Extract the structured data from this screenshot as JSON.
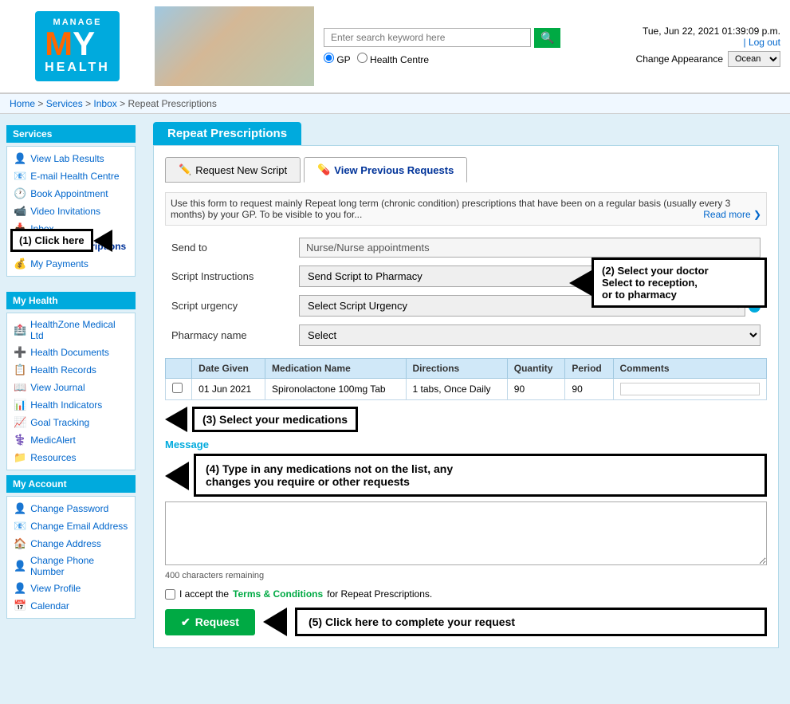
{
  "header": {
    "logo": {
      "manage_text": "MANAGE",
      "my_m": "M",
      "my_y": "Y",
      "health_text": "HEALTH"
    },
    "search": {
      "placeholder": "Enter search keyword here",
      "search_icon": "🔍",
      "radio_gp": "GP",
      "radio_hc": "Health Centre"
    },
    "info": {
      "datetime": "Tue, Jun 22, 2021 01:39:09 p.m.",
      "logout": "| Log out",
      "appearance_label": "Change Appearance",
      "appearance_value": "Ocean"
    }
  },
  "breadcrumb": {
    "items": [
      "Home",
      "Services",
      "Inbox",
      "Repeat Prescriptions"
    ]
  },
  "sidebar": {
    "services_title": "Services",
    "services_items": [
      {
        "label": "View Lab Results",
        "icon": "👤"
      },
      {
        "label": "E-mail Health Centre",
        "icon": "📧"
      },
      {
        "label": "Book Appointment",
        "icon": "🕐"
      },
      {
        "label": "Video Invitations",
        "icon": "📹"
      },
      {
        "label": "Inbox",
        "icon": "📥"
      },
      {
        "label": "Repeat Prescriptions",
        "icon": "💊",
        "active": true
      },
      {
        "label": "My Payments",
        "icon": "💰"
      }
    ],
    "myhealth_title": "My Health",
    "myhealth_items": [
      {
        "label": "HealthZone Medical Ltd",
        "icon": "🏥"
      },
      {
        "label": "Health Documents",
        "icon": "➕"
      },
      {
        "label": "Health Records",
        "icon": "📋"
      },
      {
        "label": "View Journal",
        "icon": "📖"
      },
      {
        "label": "Health Indicators",
        "icon": "📊"
      },
      {
        "label": "Goal Tracking",
        "icon": "📈"
      },
      {
        "label": "MedicAlert",
        "icon": "⚕️"
      },
      {
        "label": "Resources",
        "icon": "📁"
      }
    ],
    "myaccount_title": "My Account",
    "myaccount_items": [
      {
        "label": "Change Password",
        "icon": "👤"
      },
      {
        "label": "Change Email Address",
        "icon": "📧"
      },
      {
        "label": "Change Address",
        "icon": "🏠"
      },
      {
        "label": "Change Phone Number",
        "icon": "👤"
      },
      {
        "label": "View Profile",
        "icon": "👤"
      },
      {
        "label": "Calendar",
        "icon": "📅"
      }
    ]
  },
  "main": {
    "page_title": "Repeat Prescriptions",
    "tab_new": "Request New Script",
    "tab_previous": "View Previous Requests",
    "info_text": "Use this form to request mainly Repeat long term (chronic condition) prescriptions that have been on a regular basis (usually every 3 months) by your GP. To be visible to you for...",
    "read_more": "Read more ❯",
    "form": {
      "send_to_label": "Send to",
      "send_to_value": "Nurse/Nurse appointments",
      "script_instructions_label": "Script Instructions",
      "script_instructions_value": "Send Script to Pharmacy",
      "script_urgency_label": "Script urgency",
      "script_urgency_placeholder": "Select Script Urgency",
      "pharmacy_label": "Pharmacy name",
      "pharmacy_placeholder": "Select"
    },
    "table": {
      "headers": [
        "",
        "Date Given",
        "Medication Name",
        "Directions",
        "Quantity",
        "Period",
        "Comments"
      ],
      "rows": [
        {
          "checked": false,
          "date": "01 Jun 2021",
          "medication": "Spironolactone 100mg Tab",
          "directions": "1 tabs, Once Daily",
          "quantity": "90",
          "period": "90",
          "comments": ""
        }
      ]
    },
    "message_label": "Message",
    "chars_remaining": "400 characters remaining",
    "terms_text": "I accept the",
    "terms_link": "Terms & Conditions",
    "terms_suffix": "for Repeat Prescriptions.",
    "request_btn": "Request",
    "annotations": {
      "click_here": "(1) Click here",
      "select_doctor": "(2) Select your doctor\nSelect to reception,\nor to pharmacy",
      "select_meds": "(3) Select your medications",
      "type_meds": "(4) Type in any medications not on the list, any\nchanges you require or other requests",
      "complete_request": "(5) Click here to complete your request"
    }
  }
}
